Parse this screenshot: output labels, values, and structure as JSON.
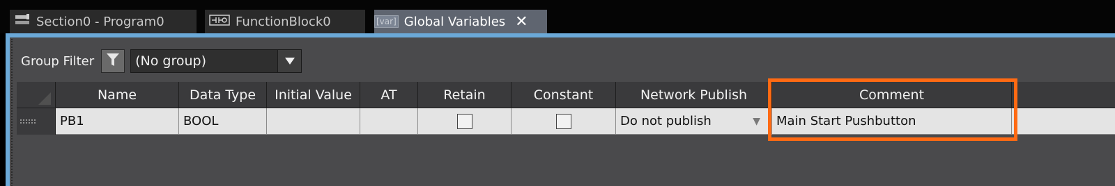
{
  "tabs": [
    {
      "label": "Section0 - Program0",
      "icon": "ladder-program-icon",
      "active": false
    },
    {
      "label": "FunctionBlock0",
      "icon": "function-block-icon",
      "active": false
    },
    {
      "label": "Global Variables",
      "icon": "variables-icon",
      "active": true,
      "icon_text": "[var]"
    }
  ],
  "close_symbol": "✕",
  "filter": {
    "label": "Group Filter",
    "selected": "(No group)"
  },
  "table": {
    "columns": [
      "Name",
      "Data Type",
      "Initial Value",
      "AT",
      "Retain",
      "Constant",
      "Network Publish",
      "Comment"
    ],
    "rows": [
      {
        "name": "PB1",
        "data_type": "BOOL",
        "initial_value": "",
        "at": "",
        "retain": false,
        "constant": false,
        "network_publish": "Do not publish",
        "comment": "Main Start Pushbutton"
      }
    ]
  },
  "colors": {
    "highlight": "#ff6a13",
    "active_tab": "#5f6570",
    "pane_border": "#6ba9d8"
  }
}
